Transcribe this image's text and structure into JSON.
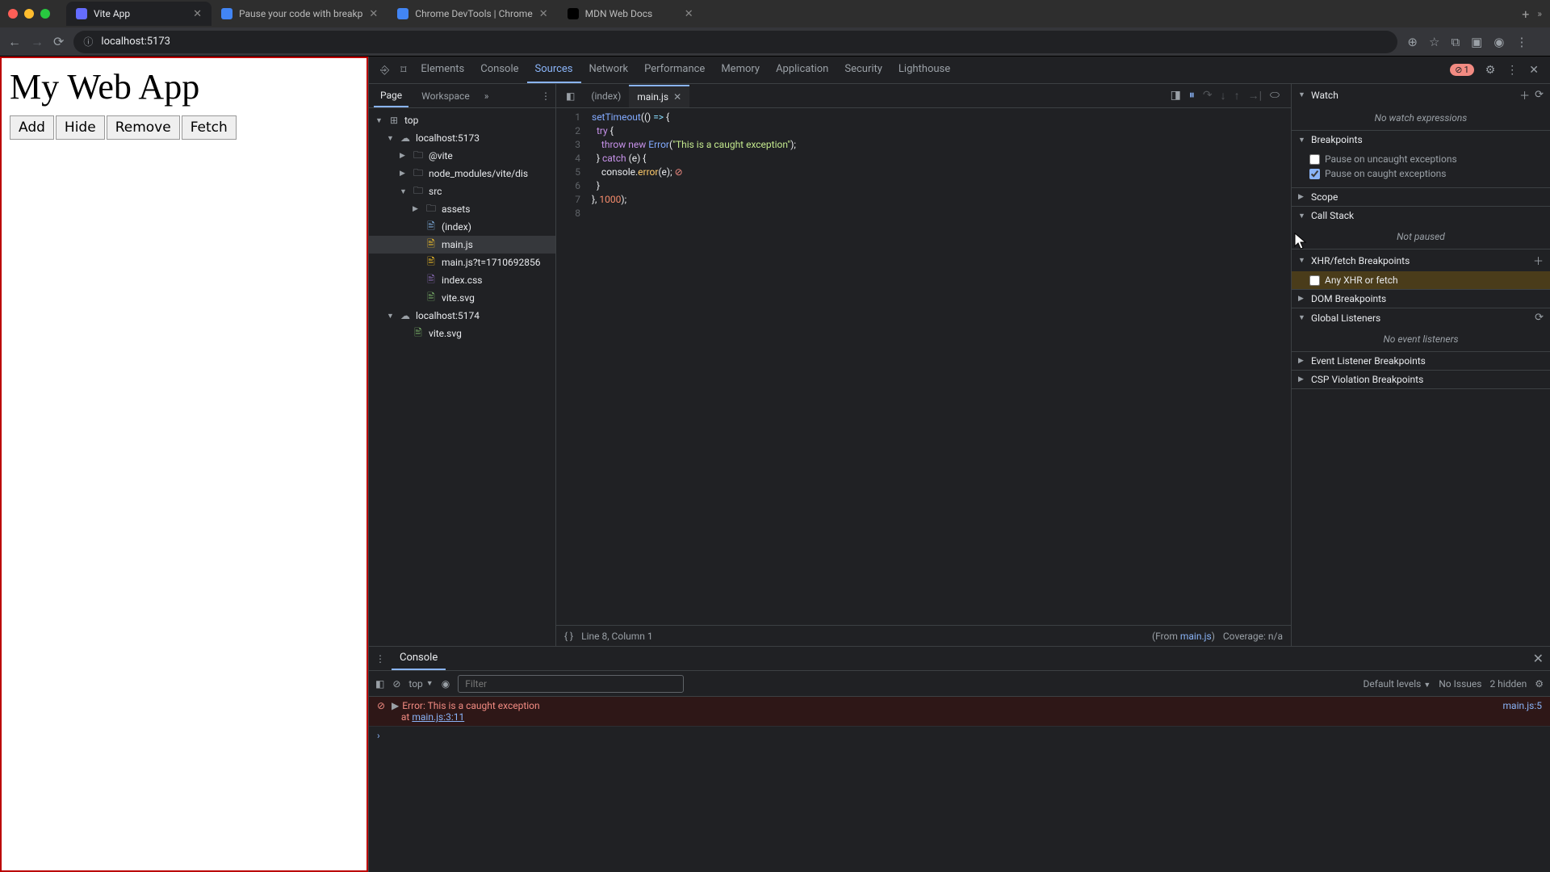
{
  "browser": {
    "tabs": [
      {
        "title": "Vite App",
        "favicon": "#646cff",
        "active": true
      },
      {
        "title": "Pause your code with breakp",
        "favicon": "#4285f4",
        "active": false
      },
      {
        "title": "Chrome DevTools  |  Chrome",
        "favicon": "#4285f4",
        "active": false
      },
      {
        "title": "MDN Web Docs",
        "favicon": "#000",
        "active": false
      }
    ],
    "url": "localhost:5173"
  },
  "viewport": {
    "heading": "My Web App",
    "buttons": [
      "Add",
      "Hide",
      "Remove",
      "Fetch"
    ]
  },
  "devtools": {
    "panels": [
      "Elements",
      "Console",
      "Sources",
      "Network",
      "Performance",
      "Memory",
      "Application",
      "Security",
      "Lighthouse"
    ],
    "activePanel": "Sources",
    "errorCount": "1",
    "sources": {
      "subTabs": {
        "items": [
          "Page",
          "Workspace"
        ],
        "active": "Page"
      },
      "tree": [
        {
          "label": "top",
          "depth": 0,
          "kind": "top",
          "open": true
        },
        {
          "label": "localhost:5173",
          "depth": 1,
          "kind": "origin",
          "open": true
        },
        {
          "label": "@vite",
          "depth": 2,
          "kind": "folder",
          "open": false
        },
        {
          "label": "node_modules/vite/dis",
          "depth": 2,
          "kind": "folder",
          "open": false
        },
        {
          "label": "src",
          "depth": 2,
          "kind": "folder",
          "open": true
        },
        {
          "label": "assets",
          "depth": 3,
          "kind": "folder",
          "open": false
        },
        {
          "label": "(index)",
          "depth": 3,
          "kind": "doc",
          "open": false
        },
        {
          "label": "main.js",
          "depth": 3,
          "kind": "js",
          "open": false,
          "selected": true
        },
        {
          "label": "main.js?t=1710692856",
          "depth": 3,
          "kind": "js",
          "open": false
        },
        {
          "label": "index.css",
          "depth": 3,
          "kind": "css",
          "open": false
        },
        {
          "label": "vite.svg",
          "depth": 3,
          "kind": "svg",
          "open": false
        },
        {
          "label": "localhost:5174",
          "depth": 1,
          "kind": "origin",
          "open": true
        },
        {
          "label": "vite.svg",
          "depth": 2,
          "kind": "svg",
          "open": false
        }
      ],
      "editorTabs": [
        {
          "label": "(index)",
          "active": false,
          "closable": false
        },
        {
          "label": "main.js",
          "active": true,
          "closable": true
        }
      ],
      "code": {
        "lines": 8,
        "l1": "setTimeout(() => {",
        "l2": "  try {",
        "l3_a": "    throw",
        "l3_b": " new",
        "l3_c": " Error",
        "l3_d": "(\"This is a caught exception\");",
        "l4": "  } catch (e) {",
        "l5_a": "    console.",
        "l5_b": "error",
        "l5_c": "(e);",
        "l6": "  }",
        "l7_a": "}, ",
        "l7_b": "1000",
        "l7_c": ");",
        "l8": ""
      },
      "status": {
        "braces": "{ }",
        "pos": "Line 8, Column 1",
        "origin": "(From ",
        "originLink": "main.js",
        "originClose": ")",
        "coverage": "Coverage: n/a"
      }
    },
    "debugger": {
      "watch": {
        "title": "Watch",
        "empty": "No watch expressions"
      },
      "breakpoints": {
        "title": "Breakpoints",
        "uncaught": {
          "label": "Pause on uncaught exceptions",
          "checked": false
        },
        "caught": {
          "label": "Pause on caught exceptions",
          "checked": true
        }
      },
      "scope": {
        "title": "Scope"
      },
      "callstack": {
        "title": "Call Stack",
        "empty": "Not paused"
      },
      "xhr": {
        "title": "XHR/fetch Breakpoints",
        "any": {
          "label": "Any XHR or fetch",
          "checked": false
        }
      },
      "dom": {
        "title": "DOM Breakpoints"
      },
      "global": {
        "title": "Global Listeners",
        "empty": "No event listeners"
      },
      "event": {
        "title": "Event Listener Breakpoints"
      },
      "csp": {
        "title": "CSP Violation Breakpoints"
      }
    }
  },
  "console": {
    "tab": "Console",
    "context": "top",
    "filterPlaceholder": "Filter",
    "levels": "Default levels",
    "issues": "No Issues",
    "hidden": "2 hidden",
    "error": {
      "text": "Error: This is a caught exception\n    at ",
      "stackLink": "main.js:3:11",
      "sourceLink": "main.js:5"
    }
  }
}
